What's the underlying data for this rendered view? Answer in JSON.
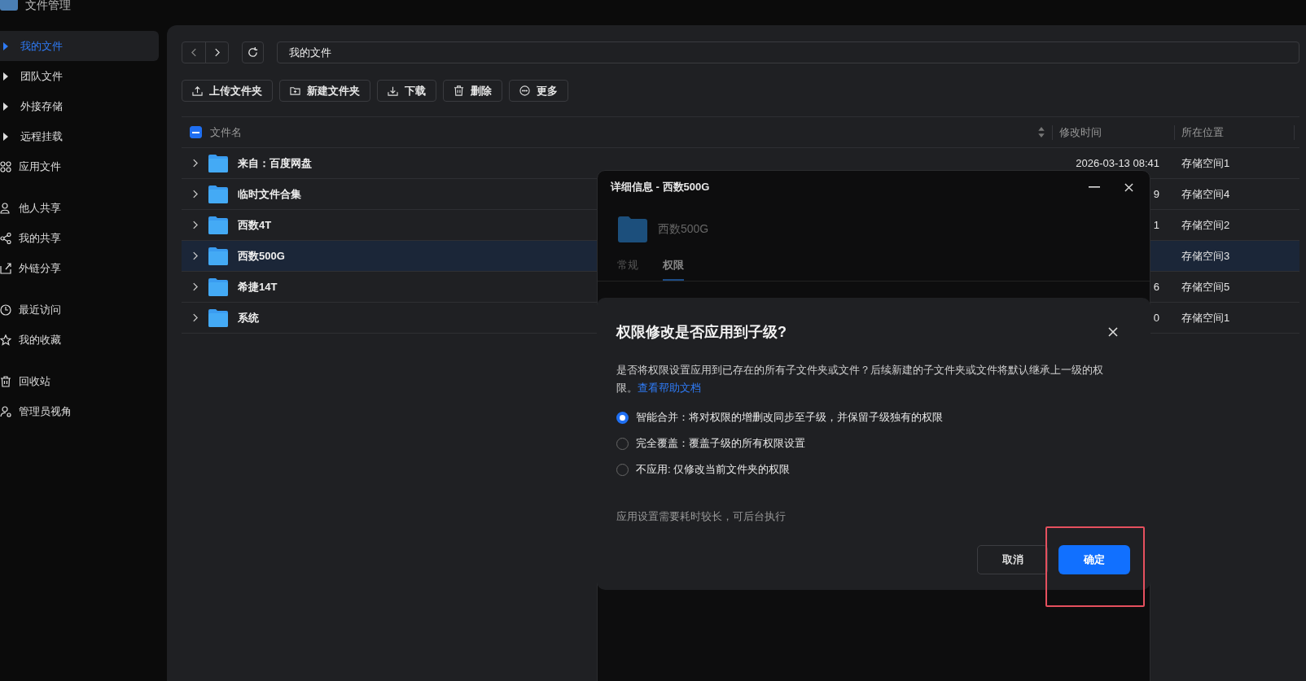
{
  "app": {
    "title": "文件管理"
  },
  "sidebar": {
    "groups": [
      {
        "items": [
          {
            "label": "我的文件",
            "kind": "tree",
            "selected": true
          },
          {
            "label": "团队文件",
            "kind": "tree",
            "selected": false
          },
          {
            "label": "外接存储",
            "kind": "tree",
            "selected": false
          },
          {
            "label": "远程挂载",
            "kind": "tree",
            "selected": false
          },
          {
            "label": "应用文件",
            "kind": "apps",
            "selected": false
          }
        ]
      },
      {
        "items": [
          {
            "label": "他人共享",
            "kind": "person",
            "selected": false
          },
          {
            "label": "我的共享",
            "kind": "share",
            "selected": false
          },
          {
            "label": "外链分享",
            "kind": "export",
            "selected": false
          }
        ]
      },
      {
        "items": [
          {
            "label": "最近访问",
            "kind": "clock",
            "selected": false
          },
          {
            "label": "我的收藏",
            "kind": "star",
            "selected": false
          }
        ]
      },
      {
        "items": [
          {
            "label": "回收站",
            "kind": "trash",
            "selected": false
          },
          {
            "label": "管理员视角",
            "kind": "admin",
            "selected": false
          }
        ]
      }
    ]
  },
  "path": "我的文件",
  "actions": [
    {
      "label": "上传文件夹",
      "kind": "upload"
    },
    {
      "label": "新建文件夹",
      "kind": "new-folder"
    },
    {
      "label": "下载",
      "kind": "download"
    },
    {
      "label": "删除",
      "kind": "trash"
    },
    {
      "label": "更多",
      "kind": "more"
    }
  ],
  "table": {
    "select_all": {
      "indeterminate": true
    },
    "columns": [
      "文件名",
      "修改时间",
      "所在位置"
    ],
    "rows": [
      {
        "name": "来自：百度网盘",
        "modified": "2026-03-13 08:41",
        "location": "存储空间1",
        "selected": false
      },
      {
        "name": "临时文件合集",
        "modified": "9",
        "location": "存储空间4",
        "selected": false
      },
      {
        "name": "西数4T",
        "modified": "1",
        "location": "存储空间2",
        "selected": false
      },
      {
        "name": "西数500G",
        "location": "存储空间3",
        "selected": true
      },
      {
        "name": "希捷14T",
        "modified": "6",
        "location": "存储空间5",
        "selected": false
      },
      {
        "name": "系统",
        "modified": "0",
        "location": "存储空间1",
        "selected": false
      }
    ]
  },
  "details_window": {
    "title": "详细信息 - 西数500G",
    "name": "西数500G",
    "tabs": [
      {
        "label": "常规",
        "selected": false
      },
      {
        "label": "权限",
        "selected": true
      }
    ]
  },
  "confirm_dialog": {
    "title": "权限修改是否应用到子级?",
    "message": "是否将权限设置应用到已存在的所有子文件夹或文件？后续新建的子文件夹或文件将默认继承上一级的权限。",
    "help_link": "查看帮助文档",
    "options": [
      {
        "label": "智能合并：将对权限的增删改同步至子级，并保留子级独有的权限",
        "selected": true
      },
      {
        "label": "完全覆盖：覆盖子级的所有权限设置",
        "selected": false
      },
      {
        "label": "不应用: 仅修改当前文件夹的权限",
        "selected": false
      }
    ],
    "note": "应用设置需要耗时较长，可后台执行",
    "buttons": [
      {
        "label": "取消",
        "kind": "secondary"
      },
      {
        "label": "确定",
        "kind": "primary",
        "highlighted": true
      }
    ]
  }
}
